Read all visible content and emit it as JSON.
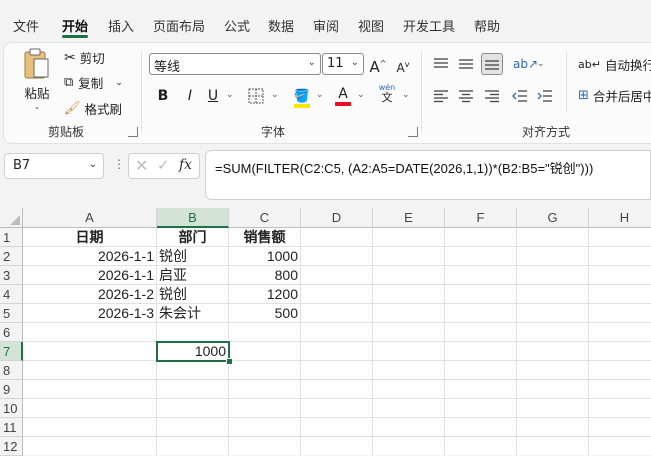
{
  "menu_tabs": [
    "文件",
    "开始",
    "插入",
    "页面布局",
    "公式",
    "数据",
    "审阅",
    "视图",
    "开发工具",
    "帮助"
  ],
  "active_tab": "开始",
  "ribbon": {
    "clipboard": {
      "paste": "粘贴",
      "cut": "剪切",
      "copy": "复制",
      "format_painter": "格式刷",
      "group_label": "剪贴板"
    },
    "font": {
      "font_name": "等线",
      "font_size": "11",
      "grow": "A",
      "shrink": "A",
      "bold": "B",
      "italic": "I",
      "underline": "U",
      "phonetic_top": "wén",
      "phonetic_bottom": "文",
      "group_label": "字体"
    },
    "alignment": {
      "wrap_text": "自动换行",
      "merge_center": "合并后居中",
      "group_label": "对齐方式"
    }
  },
  "formula_bar": {
    "name_box": "B7",
    "fx": "fx",
    "formula": "=SUM(FILTER(C2:C5, (A2:A5=DATE(2026,1,1))*(B2:B5=\"锐创\")))"
  },
  "grid": {
    "columns": [
      "A",
      "B",
      "C",
      "D",
      "E",
      "F",
      "G",
      "H"
    ],
    "rows": [
      "1",
      "2",
      "3",
      "4",
      "5",
      "6",
      "7",
      "8",
      "9",
      "10",
      "11",
      "12"
    ],
    "selected_column": "B",
    "selected_row": "7",
    "headers": {
      "a1": "日期",
      "b1": "部门",
      "c1": "销售额"
    },
    "data": [
      {
        "date": "2026-1-1",
        "dept": "锐创",
        "sales": "1000"
      },
      {
        "date": "2026-1-1",
        "dept": "启亚",
        "sales": "800"
      },
      {
        "date": "2026-1-2",
        "dept": "锐创",
        "sales": "1200"
      },
      {
        "date": "2026-1-3",
        "dept": "朱会计",
        "sales": "500"
      }
    ],
    "b7_value": "1000"
  },
  "colors": {
    "accent": "#1e7145",
    "selection_header": "#d3e3d6"
  }
}
